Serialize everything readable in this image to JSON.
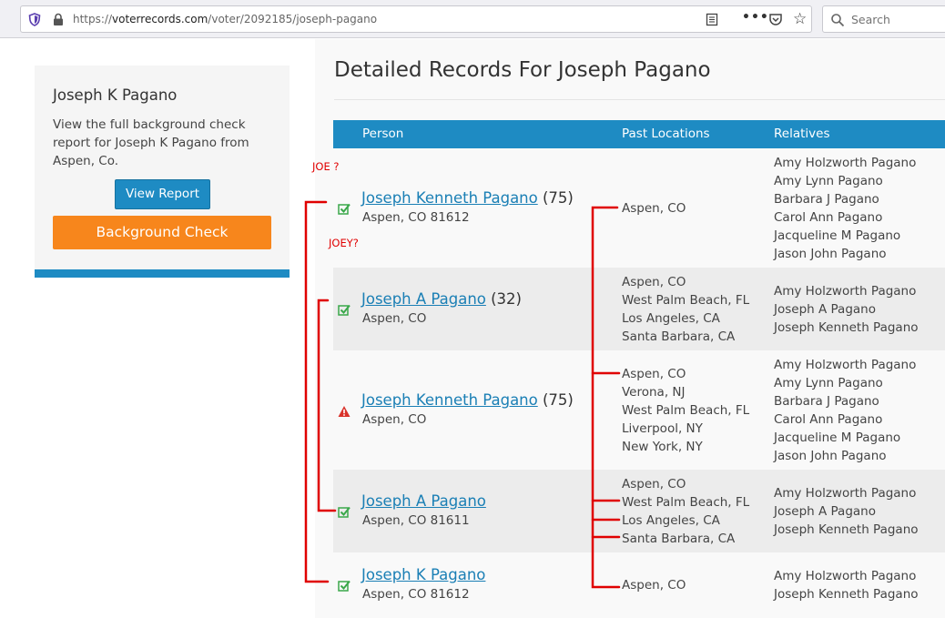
{
  "browser": {
    "url_prefix": "https://",
    "url_domain": "voterrecords.com",
    "url_path": "/voter/2092185/joseph-pagano",
    "search_placeholder": "Search",
    "menu_dots": "•••",
    "star_glyph": "☆"
  },
  "sidebar": {
    "name": "Joseph K Pagano",
    "description": "View the full background check report for Joseph K Pagano from Aspen, Co.",
    "view_report_label": "View Report",
    "background_check_label": "Background Check"
  },
  "main": {
    "title": "Detailed Records For Joseph Pagano",
    "columns": {
      "person": "Person",
      "past_locations": "Past Locations",
      "relatives": "Relatives"
    }
  },
  "records": [
    {
      "name": "Joseph Kenneth Pagano",
      "age": "(75)",
      "address": "Aspen, CO 81612",
      "status": "verified",
      "past_locations": [
        "Aspen, CO"
      ],
      "relatives": [
        "Amy Holzworth Pagano",
        "Amy Lynn Pagano",
        "Barbara J Pagano",
        "Carol Ann Pagano",
        "Jacqueline M Pagano",
        "Jason John Pagano"
      ]
    },
    {
      "name": "Joseph A Pagano",
      "age": "(32)",
      "address": "Aspen, CO",
      "status": "verified",
      "past_locations": [
        "Aspen, CO",
        "West Palm Beach, FL",
        "Los Angeles, CA",
        "Santa Barbara, CA"
      ],
      "relatives": [
        "Amy Holzworth Pagano",
        "Joseph A Pagano",
        "Joseph Kenneth Pagano"
      ]
    },
    {
      "name": "Joseph Kenneth Pagano",
      "age": "(75)",
      "address": "Aspen, CO",
      "status": "warning",
      "past_locations": [
        "Aspen, CO",
        "Verona, NJ",
        "West Palm Beach, FL",
        "Liverpool, NY",
        "New York, NY"
      ],
      "relatives": [
        "Amy Holzworth Pagano",
        "Amy Lynn Pagano",
        "Barbara J Pagano",
        "Carol Ann Pagano",
        "Jacqueline M Pagano",
        "Jason John Pagano"
      ]
    },
    {
      "name": "Joseph A Pagano",
      "age": "",
      "address": "Aspen, CO 81611",
      "status": "verified",
      "past_locations": [
        "Aspen, CO",
        "West Palm Beach, FL",
        "Los Angeles, CA",
        "Santa Barbara, CA"
      ],
      "relatives": [
        "Amy Holzworth Pagano",
        "Joseph A Pagano",
        "Joseph Kenneth Pagano"
      ]
    },
    {
      "name": "Joseph K Pagano",
      "age": "",
      "address": "Aspen, CO 81612",
      "status": "verified",
      "past_locations": [
        "Aspen, CO"
      ],
      "relatives": [
        "Amy Holzworth Pagano",
        "Joseph Kenneth Pagano"
      ]
    }
  ],
  "annotations": {
    "joe": "JOE ?",
    "joey": "JOEY?"
  },
  "colors": {
    "accent": "#1e8bc3",
    "orange": "#f7861c",
    "link": "#1a7fb5",
    "annotation": "#e00000",
    "verified": "#3aa84a",
    "warning": "#d9332b"
  }
}
